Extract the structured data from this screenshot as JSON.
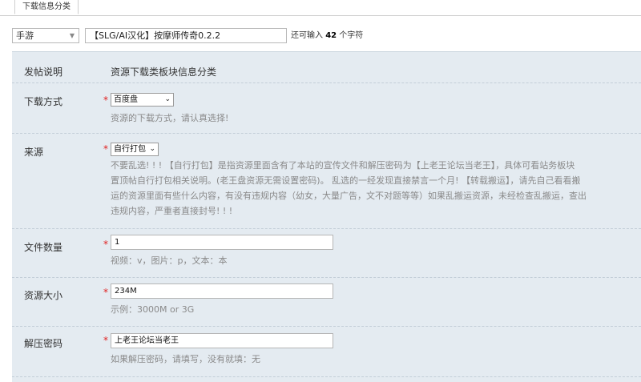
{
  "tab": {
    "label": "下载信息分类"
  },
  "top": {
    "category_value": "手游",
    "title_value": "【SLG/AI汉化】按摩师传奇0.2.2",
    "remain_prefix": "还可输入",
    "remain_count": "42",
    "remain_suffix": "个字符"
  },
  "form": {
    "intro_label": "发帖说明",
    "intro_value": "资源下载类板块信息分类",
    "download": {
      "label": "下载方式",
      "value": "百度盘",
      "hint": "资源的下载方式，请认真选择!"
    },
    "source": {
      "label": "来源",
      "value": "自行打包",
      "desc": [
        "不要乱选! ! !  【自行打包】是指资源里面含有了本站的宣传文件和解压密码为【上老王论坛当老王】，具体可看站务板块",
        "置顶帖自行打包相关说明。(老王盘资源无需设置密码)。 乱选的一经发现直接禁言一个月! 【转载搬运】，请先自己看看搬",
        "运的资源里面有些什么内容，有没有违规内容（幼女，大量广告，文不对题等等）如果乱搬运资源，未经检查乱搬运，查出",
        "违规内容，严重者直接封号! ! !"
      ]
    },
    "file_count": {
      "label": "文件数量",
      "value": "1",
      "hint": "视频：v，图片：p，文本：本"
    },
    "size": {
      "label": "资源大小",
      "value": "234M",
      "hint": "示例：3000M or 3G"
    },
    "password": {
      "label": "解压密码",
      "value": "上老王论坛当老王",
      "hint": "如果解压密码，请填写，没有就填：无"
    }
  },
  "required_mark": "*"
}
